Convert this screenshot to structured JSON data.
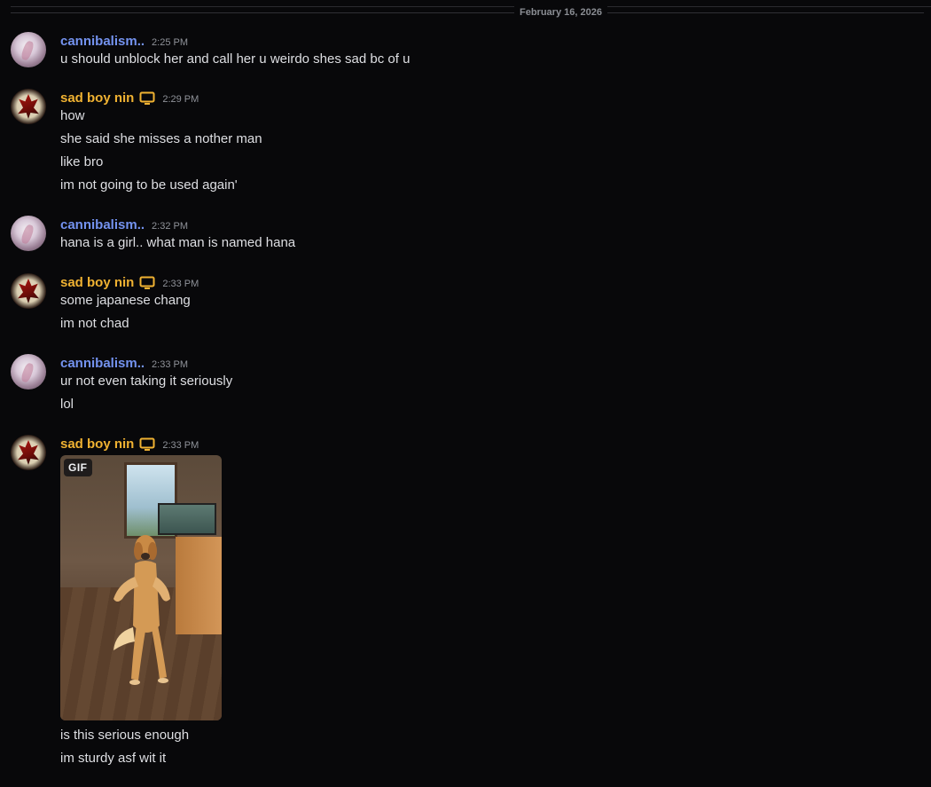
{
  "date_divider": "February 16, 2026",
  "colors": {
    "background": "#08080a",
    "author_cannibalism": "#7493f0",
    "author_sadboy": "#f0b232",
    "text": "#dedfe3",
    "timestamp": "#8f9299"
  },
  "messages": [
    {
      "author": "cannibalism..",
      "time": "2:25 PM",
      "lines": [
        "u should unblock her and call her u weirdo shes sad bc of u"
      ]
    },
    {
      "author": "sad boy nin",
      "device_icon": "desktop-icon",
      "time": "2:29 PM",
      "lines": [
        "how",
        "she said she misses a nother man",
        "like bro",
        "im not going to be used again'"
      ]
    },
    {
      "author": "cannibalism..",
      "time": "2:32 PM",
      "lines": [
        "hana is a girl.. what man is named hana"
      ]
    },
    {
      "author": "sad boy nin",
      "device_icon": "desktop-icon",
      "time": "2:33 PM",
      "lines": [
        "some japanese chang",
        "im not chad"
      ]
    },
    {
      "author": "cannibalism..",
      "time": "2:33 PM",
      "lines": [
        "ur not even taking it seriously",
        "lol"
      ]
    },
    {
      "author": "sad boy nin",
      "device_icon": "desktop-icon",
      "time": "2:33 PM",
      "attachment_badge": "GIF",
      "lines": [
        "is this serious enough",
        "im sturdy asf wit it"
      ]
    }
  ]
}
